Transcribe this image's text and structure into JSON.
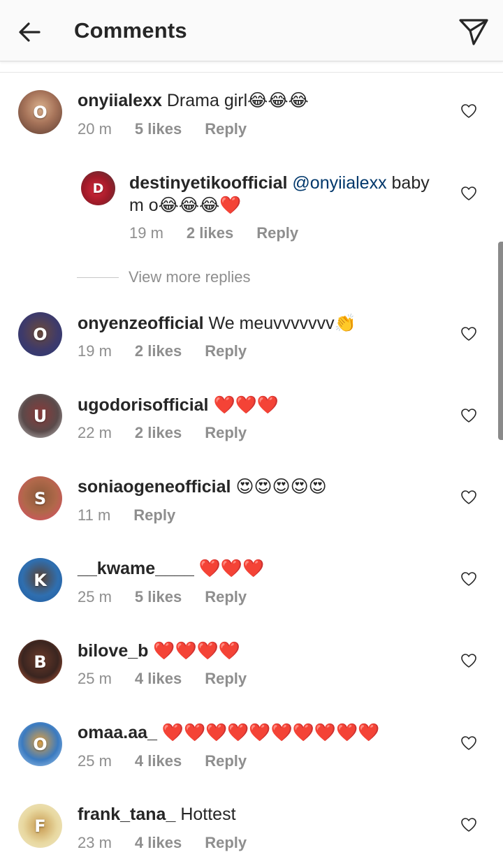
{
  "header": {
    "title": "Comments",
    "back_icon": "arrow-left-icon",
    "share_icon": "paper-plane-icon"
  },
  "colors": {
    "text": "#262626",
    "muted": "#8e8e8e",
    "mention": "#00376b",
    "heart": "#e8232f"
  },
  "comments": [
    {
      "username": "onyiialexx",
      "text": "Drama girl😂😂😂",
      "time": "20 m",
      "likes": "5 likes",
      "reply": "Reply",
      "avatar_initial": "O"
    },
    {
      "username": "destinyetikoofficial",
      "mention": "@onyiialexx",
      "text_line1": " baby",
      "text_line2": "m o😂😂😂❤️",
      "time": "19 m",
      "likes": "2 likes",
      "reply": "Reply",
      "avatar_initial": "D"
    },
    {
      "username": "onyenzeofficial",
      "text": "We meuvvvvvvv👏",
      "time": "19 m",
      "likes": "2 likes",
      "reply": "Reply",
      "avatar_initial": "O"
    },
    {
      "username": "ugodorisofficial",
      "text": "❤️❤️❤️",
      "time": "22 m",
      "likes": "2 likes",
      "reply": "Reply",
      "avatar_initial": "U"
    },
    {
      "username": "soniaogeneofficial",
      "text": "😍😍😍😍😍",
      "time": "11 m",
      "reply": "Reply",
      "avatar_initial": "S"
    },
    {
      "username": "__kwame____",
      "text": "❤️❤️❤️",
      "time": "25 m",
      "likes": "5 likes",
      "reply": "Reply",
      "avatar_initial": "K"
    },
    {
      "username": "bilove_b",
      "text": "❤️❤️❤️❤️",
      "time": "25 m",
      "likes": "4 likes",
      "reply": "Reply",
      "avatar_initial": "B"
    },
    {
      "username": "omaa.aa_",
      "text": "❤️❤️❤️❤️❤️❤️❤️❤️❤️❤️",
      "time": "25 m",
      "likes": "4 likes",
      "reply": "Reply",
      "avatar_initial": "O"
    },
    {
      "username": "frank_tana_",
      "text": "Hottest",
      "time": "23 m",
      "likes": "4 likes",
      "reply": "Reply",
      "avatar_initial": "F"
    }
  ],
  "view_more_replies": "View more replies"
}
